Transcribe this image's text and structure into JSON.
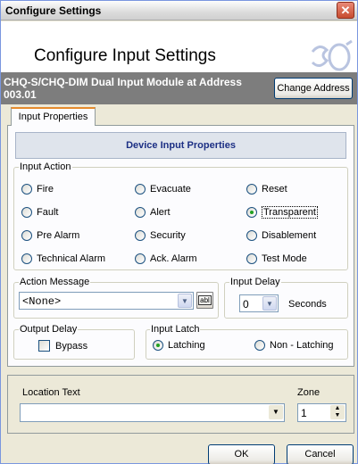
{
  "window": {
    "title": "Configure Settings",
    "close_glyph": "✕"
  },
  "header": {
    "title": "Configure Input Settings",
    "logo_icon": "product-logo-icon"
  },
  "module": {
    "title": "CHQ-S/CHQ-DIM Dual Input Module at Address 003.01",
    "change_address_label": "Change Address"
  },
  "tabs": [
    {
      "label": "Input Properties"
    }
  ],
  "device_panel": {
    "title": "Device Input Properties"
  },
  "input_action": {
    "label": "Input Action",
    "options": [
      {
        "label": "Fire",
        "checked": false
      },
      {
        "label": "Evacuate",
        "checked": false
      },
      {
        "label": "Reset",
        "checked": false
      },
      {
        "label": "Fault",
        "checked": false
      },
      {
        "label": "Alert",
        "checked": false
      },
      {
        "label": "Transparent",
        "checked": true
      },
      {
        "label": "Pre Alarm",
        "checked": false
      },
      {
        "label": "Security",
        "checked": false
      },
      {
        "label": "Disablement",
        "checked": false
      },
      {
        "label": "Technical Alarm",
        "checked": false
      },
      {
        "label": "Ack. Alarm",
        "checked": false
      },
      {
        "label": "Test Mode",
        "checked": false
      }
    ]
  },
  "action_message": {
    "label": "Action Message",
    "value": "<None>",
    "edit_button": "abl"
  },
  "input_delay": {
    "label": "Input Delay",
    "value": "0",
    "unit": "Seconds"
  },
  "output_delay": {
    "label": "Output Delay",
    "bypass_label": "Bypass",
    "bypass_checked": false
  },
  "input_latch": {
    "label": "Input Latch",
    "options": [
      {
        "label": "Latching",
        "checked": true
      },
      {
        "label": "Non - Latching",
        "checked": false
      }
    ]
  },
  "location": {
    "label": "Location Text",
    "value": ""
  },
  "zone": {
    "label": "Zone",
    "value": "1"
  },
  "footer": {
    "ok_label": "OK",
    "cancel_label": "Cancel"
  }
}
